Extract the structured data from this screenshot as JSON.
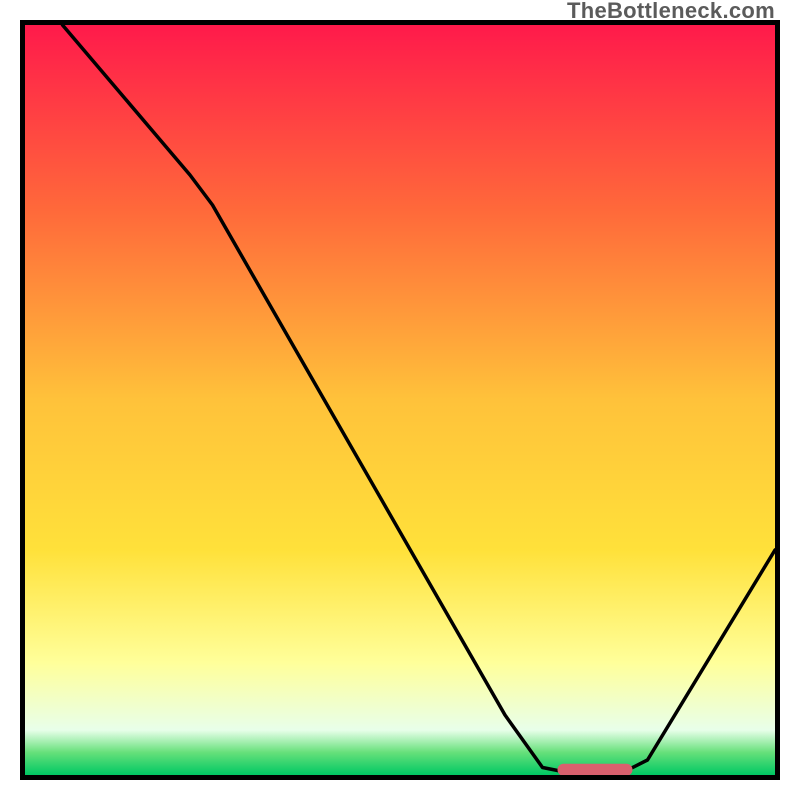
{
  "watermark": "TheBottleneck.com",
  "chart_data": {
    "type": "line",
    "title": "",
    "xlabel": "",
    "ylabel": "",
    "xlim": [
      0,
      100
    ],
    "ylim": [
      0,
      100
    ],
    "background_gradient": {
      "stops": [
        {
          "offset": 0,
          "color": "#ff1a4b"
        },
        {
          "offset": 25,
          "color": "#ff6a3a"
        },
        {
          "offset": 50,
          "color": "#ffc23a"
        },
        {
          "offset": 70,
          "color": "#ffe13a"
        },
        {
          "offset": 85,
          "color": "#ffff9a"
        },
        {
          "offset": 94,
          "color": "#e8ffea"
        },
        {
          "offset": 97,
          "color": "#66e07a"
        },
        {
          "offset": 100,
          "color": "#00c864"
        }
      ]
    },
    "series": [
      {
        "name": "bottleneck-curve",
        "color": "#000000",
        "stroke_width": 3.5,
        "points": [
          {
            "x": 5,
            "y": 100
          },
          {
            "x": 22,
            "y": 80
          },
          {
            "x": 25,
            "y": 76
          },
          {
            "x": 64,
            "y": 8
          },
          {
            "x": 69,
            "y": 1
          },
          {
            "x": 74,
            "y": 0
          },
          {
            "x": 80,
            "y": 0.5
          },
          {
            "x": 83,
            "y": 2
          },
          {
            "x": 100,
            "y": 30
          }
        ]
      }
    ],
    "marker": {
      "name": "optimal-range",
      "x_center": 76,
      "y": 0.7,
      "width": 10,
      "height": 1.6,
      "color": "#d9606e",
      "rx": 5
    }
  }
}
